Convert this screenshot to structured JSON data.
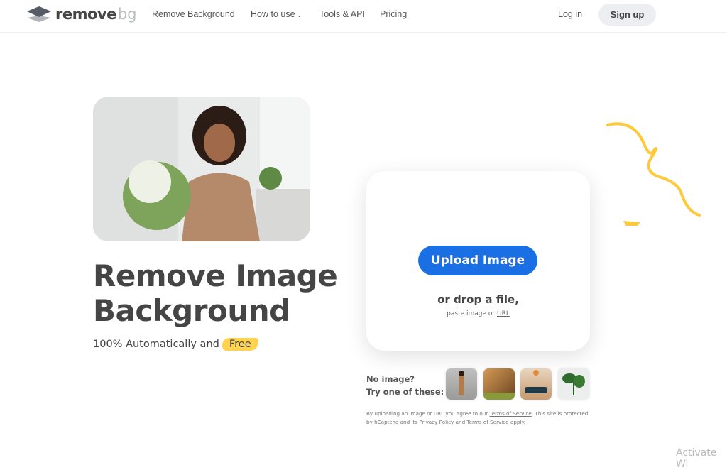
{
  "nav": {
    "logo_main": "remove",
    "logo_accent": "bg",
    "links": [
      "Remove Background",
      "How to use",
      "Tools & API",
      "Pricing"
    ],
    "login": "Log in",
    "signup": "Sign up"
  },
  "hero": {
    "title_line1": "Remove Image",
    "title_line2": "Background",
    "subtitle": "100% Automatically and",
    "free": "Free"
  },
  "upload": {
    "button": "Upload Image",
    "drop": "or drop a file,",
    "paste": "paste image or",
    "url": "URL"
  },
  "samples": {
    "line1": "No image?",
    "line2": "Try one of these:",
    "items": [
      "woman-with-scooter",
      "lion",
      "car-with-balloon",
      "plant"
    ]
  },
  "legal": {
    "t1": "By uploading an image or URL you agree to our",
    "tos": "Terms of Service",
    "t2": ". This site is protected by hCaptcha and its",
    "privacy": "Privacy Policy",
    "t3": "and",
    "tos2": "Terms of Service",
    "t4": "apply."
  },
  "watermark": "Activate Wi",
  "colors": {
    "accent": "#1a6fe5",
    "highlight": "#ffd34e",
    "text": "#454545"
  }
}
